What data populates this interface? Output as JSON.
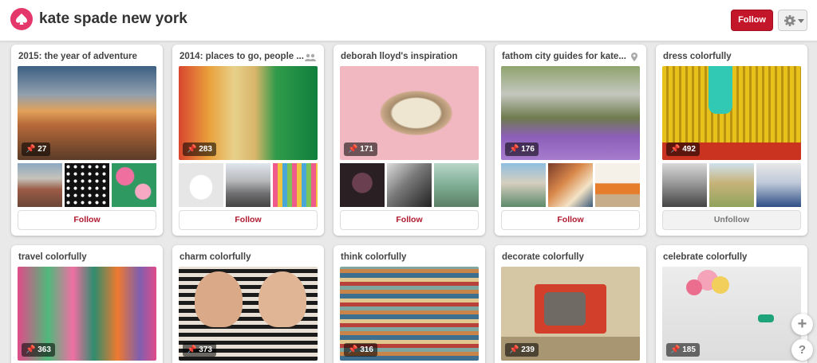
{
  "header": {
    "brand_name": "kate spade new york",
    "follow_label": "Follow",
    "logo_icon": "spade-logo-icon",
    "settings_icon": "gear-icon"
  },
  "boards": [
    {
      "title": "2015: the year of adventure",
      "pin_count": "27",
      "button": "Follow"
    },
    {
      "title": "2014: places to go, people ...",
      "pin_count": "283",
      "button": "Follow",
      "icon": "collaborators-icon"
    },
    {
      "title": "deborah lloyd's inspiration",
      "pin_count": "171",
      "button": "Follow"
    },
    {
      "title": "fathom city guides for kate...",
      "pin_count": "176",
      "button": "Follow",
      "icon": "location-icon"
    },
    {
      "title": "dress colorfully",
      "pin_count": "492",
      "button": "Unfollow"
    },
    {
      "title": "travel colorfully",
      "pin_count": "363"
    },
    {
      "title": "charm colorfully",
      "pin_count": "373"
    },
    {
      "title": "think colorfully",
      "pin_count": "316"
    },
    {
      "title": "decorate colorfully",
      "pin_count": "239"
    },
    {
      "title": "celebrate colorfully",
      "pin_count": "185"
    }
  ],
  "floating": {
    "add_icon": "plus-icon",
    "add_label": "+",
    "help_icon": "question-icon",
    "help_label": "?"
  },
  "colors": {
    "brand": "#e4386b",
    "follow_red": "#c4162a",
    "background": "#e9e9e9"
  }
}
